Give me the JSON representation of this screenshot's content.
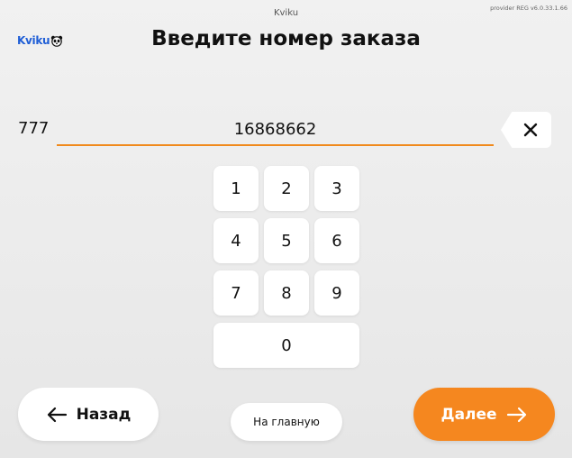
{
  "header": {
    "window_title": "Kviku",
    "version": "provider REG v6.0.33.1.66",
    "logo_text": "Kviku",
    "logo_icon": "panda-icon",
    "title": "Введите номер заказа"
  },
  "order": {
    "prefix": "777",
    "value": "16868662",
    "clear_icon": "close-icon"
  },
  "keypad": {
    "keys": [
      "1",
      "2",
      "3",
      "4",
      "5",
      "6",
      "7",
      "8",
      "9",
      "0"
    ]
  },
  "footer": {
    "back_label": "Назад",
    "back_icon": "arrow-left-icon",
    "home_label": "На главную",
    "next_label": "Далее",
    "next_icon": "arrow-right-icon"
  },
  "colors": {
    "accent": "#f5871f",
    "logo_blue": "#1f5ed6"
  }
}
